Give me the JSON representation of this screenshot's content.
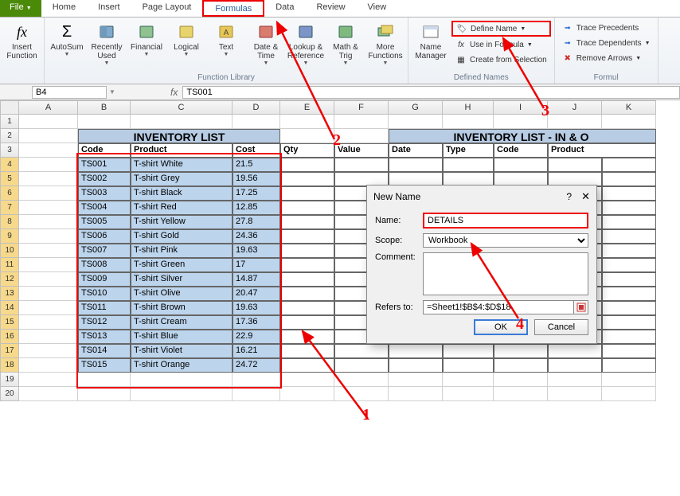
{
  "tabs": {
    "file": "File",
    "home": "Home",
    "insert": "Insert",
    "pageLayout": "Page Layout",
    "formulas": "Formulas",
    "data": "Data",
    "review": "Review",
    "view": "View"
  },
  "ribbon": {
    "insertFunction": "Insert\nFunction",
    "autoSum": "AutoSum",
    "recentlyUsed": "Recently\nUsed",
    "financial": "Financial",
    "logical": "Logical",
    "text": "Text",
    "dateTime": "Date &\nTime",
    "lookupRef": "Lookup &\nReference",
    "mathTrig": "Math &\nTrig",
    "moreFunctions": "More\nFunctions",
    "groupFunctionLibrary": "Function Library",
    "nameManager": "Name\nManager",
    "defineName": "Define Name",
    "useInFormula": "Use in Formula",
    "createFromSelection": "Create from Selection",
    "groupDefinedNames": "Defined Names",
    "tracePrecedents": "Trace Precedents",
    "traceDependents": "Trace Dependents",
    "removeArrows": "Remove Arrows",
    "groupFormula": "Formul"
  },
  "namebox": "B4",
  "formulaBar": "TS001",
  "columns": [
    "A",
    "B",
    "C",
    "D",
    "E",
    "F",
    "G",
    "H",
    "I",
    "J",
    "K"
  ],
  "rows": [
    "1",
    "2",
    "3",
    "4",
    "5",
    "6",
    "7",
    "8",
    "9",
    "10",
    "11",
    "12",
    "13",
    "14",
    "15",
    "16",
    "17",
    "18",
    "19",
    "20"
  ],
  "inventory": {
    "title": "INVENTORY LIST",
    "headers": {
      "code": "Code",
      "product": "Product",
      "cost": "Cost",
      "qty": "Qty",
      "value": "Value"
    },
    "rows": [
      {
        "code": "TS001",
        "product": "T-shirt White",
        "cost": "21.5"
      },
      {
        "code": "TS002",
        "product": "T-shirt Grey",
        "cost": "19.56"
      },
      {
        "code": "TS003",
        "product": "T-shirt Black",
        "cost": "17.25"
      },
      {
        "code": "TS004",
        "product": "T-shirt Red",
        "cost": "12.85"
      },
      {
        "code": "TS005",
        "product": "T-shirt Yellow",
        "cost": "27.8"
      },
      {
        "code": "TS006",
        "product": "T-shirt Gold",
        "cost": "24.36"
      },
      {
        "code": "TS007",
        "product": "T-shirt Pink",
        "cost": "19.63"
      },
      {
        "code": "TS008",
        "product": "T-shirt Green",
        "cost": "17"
      },
      {
        "code": "TS009",
        "product": "T-shirt Silver",
        "cost": "14.87"
      },
      {
        "code": "TS010",
        "product": "T-shirt Olive",
        "cost": "20.47"
      },
      {
        "code": "TS011",
        "product": "T-shirt Brown",
        "cost": "19.63"
      },
      {
        "code": "TS012",
        "product": "T-shirt Cream",
        "cost": "17.36"
      },
      {
        "code": "TS013",
        "product": "T-shirt Blue",
        "cost": "22.9"
      },
      {
        "code": "TS014",
        "product": "T-shirt Violet",
        "cost": "16.21"
      },
      {
        "code": "TS015",
        "product": "T-shirt Orange",
        "cost": "24.72"
      }
    ]
  },
  "inout": {
    "title": "INVENTORY LIST - IN & O",
    "headers": {
      "date": "Date",
      "type": "Type",
      "code": "Code",
      "product": "Product"
    }
  },
  "dialog": {
    "title": "New Name",
    "nameLabel": "Name:",
    "nameValue": "DETAILS",
    "scopeLabel": "Scope:",
    "scopeValue": "Workbook",
    "commentLabel": "Comment:",
    "refersLabel": "Refers to:",
    "refersValue": "=Sheet1!$B$4:$D$18",
    "ok": "OK",
    "cancel": "Cancel"
  },
  "annotations": {
    "n1": "1",
    "n2": "2",
    "n3": "3",
    "n4": "4"
  },
  "colWidths": {
    "A": 74,
    "B": 66,
    "C": 128,
    "D": 60,
    "E": 68,
    "F": 68,
    "G": 68,
    "H": 64,
    "I": 68,
    "J": 68,
    "K": 68
  }
}
